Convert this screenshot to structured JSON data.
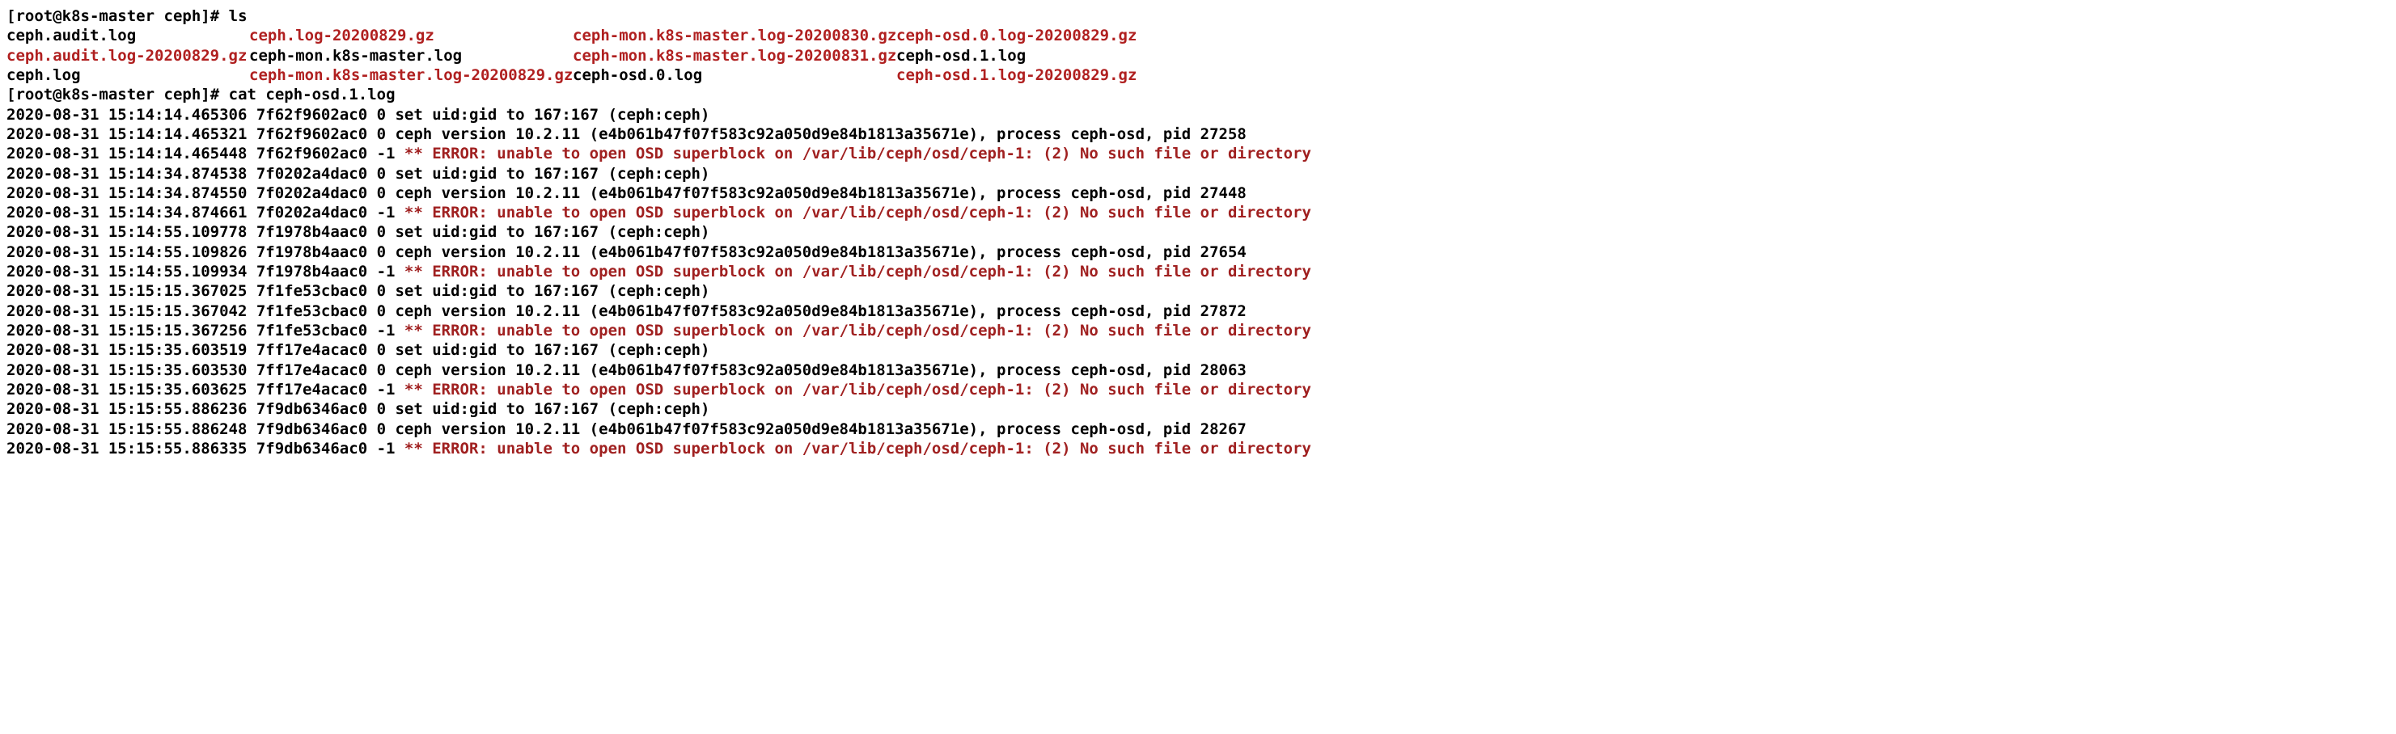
{
  "prompt": {
    "user": "root",
    "host": "k8s-master",
    "path": "ceph",
    "symbol": "#"
  },
  "commands": {
    "ls": "ls",
    "cat": "cat ceph-osd.1.log"
  },
  "ls": {
    "rows": [
      {
        "c1": {
          "text": "ceph.audit.log",
          "cls": "file-plain"
        },
        "c2": {
          "text": "ceph.log-20200829.gz",
          "cls": "file-red"
        },
        "c3": {
          "text": "ceph-mon.k8s-master.log-20200830.gz",
          "cls": "file-red"
        },
        "c4": {
          "text": "ceph-osd.0.log-20200829.gz",
          "cls": "file-red"
        }
      },
      {
        "c1": {
          "text": "ceph.audit.log-20200829.gz",
          "cls": "file-red"
        },
        "c2": {
          "text": "ceph-mon.k8s-master.log",
          "cls": "file-plain"
        },
        "c3": {
          "text": "ceph-mon.k8s-master.log-20200831.gz",
          "cls": "file-red"
        },
        "c4": {
          "text": "ceph-osd.1.log",
          "cls": "file-plain"
        }
      },
      {
        "c1": {
          "text": "ceph.log",
          "cls": "file-plain"
        },
        "c2": {
          "text": "ceph-mon.k8s-master.log-20200829.gz",
          "cls": "file-red"
        },
        "c3": {
          "text": "ceph-osd.0.log",
          "cls": "file-plain"
        },
        "c4": {
          "text": "ceph-osd.1.log-20200829.gz",
          "cls": "file-red"
        }
      }
    ]
  },
  "log": {
    "version_hash": "(e4b061b47f07f583c92a050d9e84b1813a35671e)",
    "version_proc": "ceph version 10.2.11",
    "uidgid": "set uid:gid to 167:167 (ceph:ceph)",
    "error": "** ERROR: unable to open OSD superblock on /var/lib/ceph/osd/ceph-1: (2) No such file or directory",
    "entries": [
      {
        "ts": "2020-08-31 15:14:14.465306",
        "th": "7f62f9602ac0",
        "lvl": " 0",
        "type": "uid"
      },
      {
        "ts": "2020-08-31 15:14:14.465321",
        "th": "7f62f9602ac0",
        "lvl": " 0",
        "type": "ver",
        "pid": "27258"
      },
      {
        "ts": "2020-08-31 15:14:14.465448",
        "th": "7f62f9602ac0",
        "lvl": "-1",
        "type": "err"
      },
      {
        "ts": "2020-08-31 15:14:34.874538",
        "th": "7f0202a4dac0",
        "lvl": " 0",
        "type": "uid"
      },
      {
        "ts": "2020-08-31 15:14:34.874550",
        "th": "7f0202a4dac0",
        "lvl": " 0",
        "type": "ver",
        "pid": "27448"
      },
      {
        "ts": "2020-08-31 15:14:34.874661",
        "th": "7f0202a4dac0",
        "lvl": "-1",
        "type": "err"
      },
      {
        "ts": "2020-08-31 15:14:55.109778",
        "th": "7f1978b4aac0",
        "lvl": " 0",
        "type": "uid"
      },
      {
        "ts": "2020-08-31 15:14:55.109826",
        "th": "7f1978b4aac0",
        "lvl": " 0",
        "type": "ver",
        "pid": "27654"
      },
      {
        "ts": "2020-08-31 15:14:55.109934",
        "th": "7f1978b4aac0",
        "lvl": "-1",
        "type": "err"
      },
      {
        "ts": "2020-08-31 15:15:15.367025",
        "th": "7f1fe53cbac0",
        "lvl": " 0",
        "type": "uid"
      },
      {
        "ts": "2020-08-31 15:15:15.367042",
        "th": "7f1fe53cbac0",
        "lvl": " 0",
        "type": "ver",
        "pid": "27872"
      },
      {
        "ts": "2020-08-31 15:15:15.367256",
        "th": "7f1fe53cbac0",
        "lvl": "-1",
        "type": "err"
      },
      {
        "ts": "2020-08-31 15:15:35.603519",
        "th": "7ff17e4acac0",
        "lvl": " 0",
        "type": "uid"
      },
      {
        "ts": "2020-08-31 15:15:35.603530",
        "th": "7ff17e4acac0",
        "lvl": " 0",
        "type": "ver",
        "pid": "28063"
      },
      {
        "ts": "2020-08-31 15:15:35.603625",
        "th": "7ff17e4acac0",
        "lvl": "-1",
        "type": "err"
      },
      {
        "ts": "2020-08-31 15:15:55.886236",
        "th": "7f9db6346ac0",
        "lvl": " 0",
        "type": "uid"
      },
      {
        "ts": "2020-08-31 15:15:55.886248",
        "th": "7f9db6346ac0",
        "lvl": " 0",
        "type": "ver",
        "pid": "28267"
      },
      {
        "ts": "2020-08-31 15:15:55.886335",
        "th": "7f9db6346ac0",
        "lvl": "-1",
        "type": "err"
      }
    ]
  }
}
